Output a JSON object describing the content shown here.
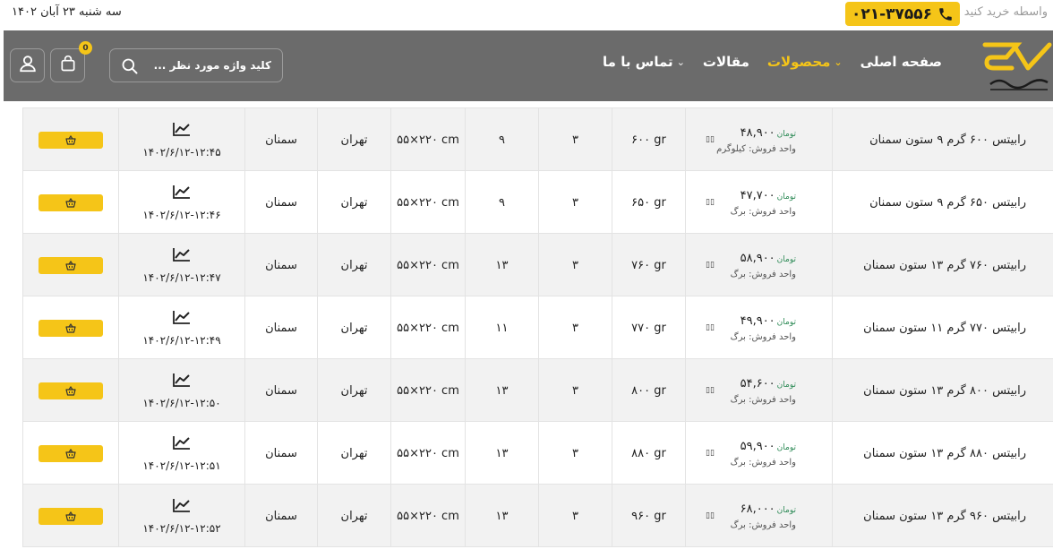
{
  "topbar": {
    "date": "سه شنبه ۲۳ آبان ۱۴۰۲",
    "buy_text": "واسطه خرید کنید",
    "phone": "۰۲۱-۳۷۵۵۶"
  },
  "header": {
    "nav": [
      {
        "label": "صفحه اصلی",
        "active": false,
        "dropdown": false
      },
      {
        "label": "محصولات",
        "active": true,
        "dropdown": true
      },
      {
        "label": "مقالات",
        "active": false,
        "dropdown": false
      },
      {
        "label": "تماس با ما",
        "active": false,
        "dropdown": true
      }
    ],
    "search_placeholder": "کلید واژه مورد نظر ...",
    "cart_count": "0"
  },
  "colors": {
    "accent": "#f5c518",
    "header_bg": "#6b6b6b",
    "price_unit": "#2e8b57"
  },
  "table": {
    "rows": [
      {
        "name": "رابیتس ۶۰۰ گرم ۹ ستون سمنان",
        "price": "۴۸,۹۰۰",
        "currency": "تومان",
        "unit": "واحد فروش: کیلوگرم",
        "weight": "۶۰۰ gr",
        "count": "۳",
        "cols": "۹",
        "size": "۵۵×۲۲۰ cm",
        "loc1": "تهران",
        "loc2": "سمنان",
        "date": "۱۴۰۲/۶/۱۲-۱۲:۴۵"
      },
      {
        "name": "رابیتس ۶۵۰ گرم ۹ ستون سمنان",
        "price": "۴۷,۷۰۰",
        "currency": "تومان",
        "unit": "واحد فروش: برگ",
        "weight": "۶۵۰ gr",
        "count": "۳",
        "cols": "۹",
        "size": "۵۵×۲۲۰ cm",
        "loc1": "تهران",
        "loc2": "سمنان",
        "date": "۱۴۰۲/۶/۱۲-۱۲:۴۶"
      },
      {
        "name": "رابیتس ۷۶۰ گرم ۱۳ ستون سمنان",
        "price": "۵۸,۹۰۰",
        "currency": "تومان",
        "unit": "واحد فروش: برگ",
        "weight": "۷۶۰ gr",
        "count": "۳",
        "cols": "۱۳",
        "size": "۵۵×۲۲۰ cm",
        "loc1": "تهران",
        "loc2": "سمنان",
        "date": "۱۴۰۲/۶/۱۲-۱۲:۴۷"
      },
      {
        "name": "رابیتس ۷۷۰ گرم ۱۱ ستون سمنان",
        "price": "۴۹,۹۰۰",
        "currency": "تومان",
        "unit": "واحد فروش: برگ",
        "weight": "۷۷۰ gr",
        "count": "۳",
        "cols": "۱۱",
        "size": "۵۵×۲۲۰ cm",
        "loc1": "تهران",
        "loc2": "سمنان",
        "date": "۱۴۰۲/۶/۱۲-۱۲:۴۹"
      },
      {
        "name": "رابیتس ۸۰۰ گرم ۱۳ ستون سمنان",
        "price": "۵۴,۶۰۰",
        "currency": "تومان",
        "unit": "واحد فروش: برگ",
        "weight": "۸۰۰ gr",
        "count": "۳",
        "cols": "۱۳",
        "size": "۵۵×۲۲۰ cm",
        "loc1": "تهران",
        "loc2": "سمنان",
        "date": "۱۴۰۲/۶/۱۲-۱۲:۵۰"
      },
      {
        "name": "رابیتس ۸۸۰ گرم ۱۳ ستون سمنان",
        "price": "۵۹,۹۰۰",
        "currency": "تومان",
        "unit": "واحد فروش: برگ",
        "weight": "۸۸۰ gr",
        "count": "۳",
        "cols": "۱۳",
        "size": "۵۵×۲۲۰ cm",
        "loc1": "تهران",
        "loc2": "سمنان",
        "date": "۱۴۰۲/۶/۱۲-۱۲:۵۱"
      },
      {
        "name": "رابیتس ۹۶۰ گرم ۱۳ ستون سمنان",
        "price": "۶۸,۰۰۰",
        "currency": "تومان",
        "unit": "واحد فروش: برگ",
        "weight": "۹۶۰ gr",
        "count": "۳",
        "cols": "۱۳",
        "size": "۵۵×۲۲۰ cm",
        "loc1": "تهران",
        "loc2": "سمنان",
        "date": "۱۴۰۲/۶/۱۲-۱۲:۵۲"
      }
    ]
  }
}
